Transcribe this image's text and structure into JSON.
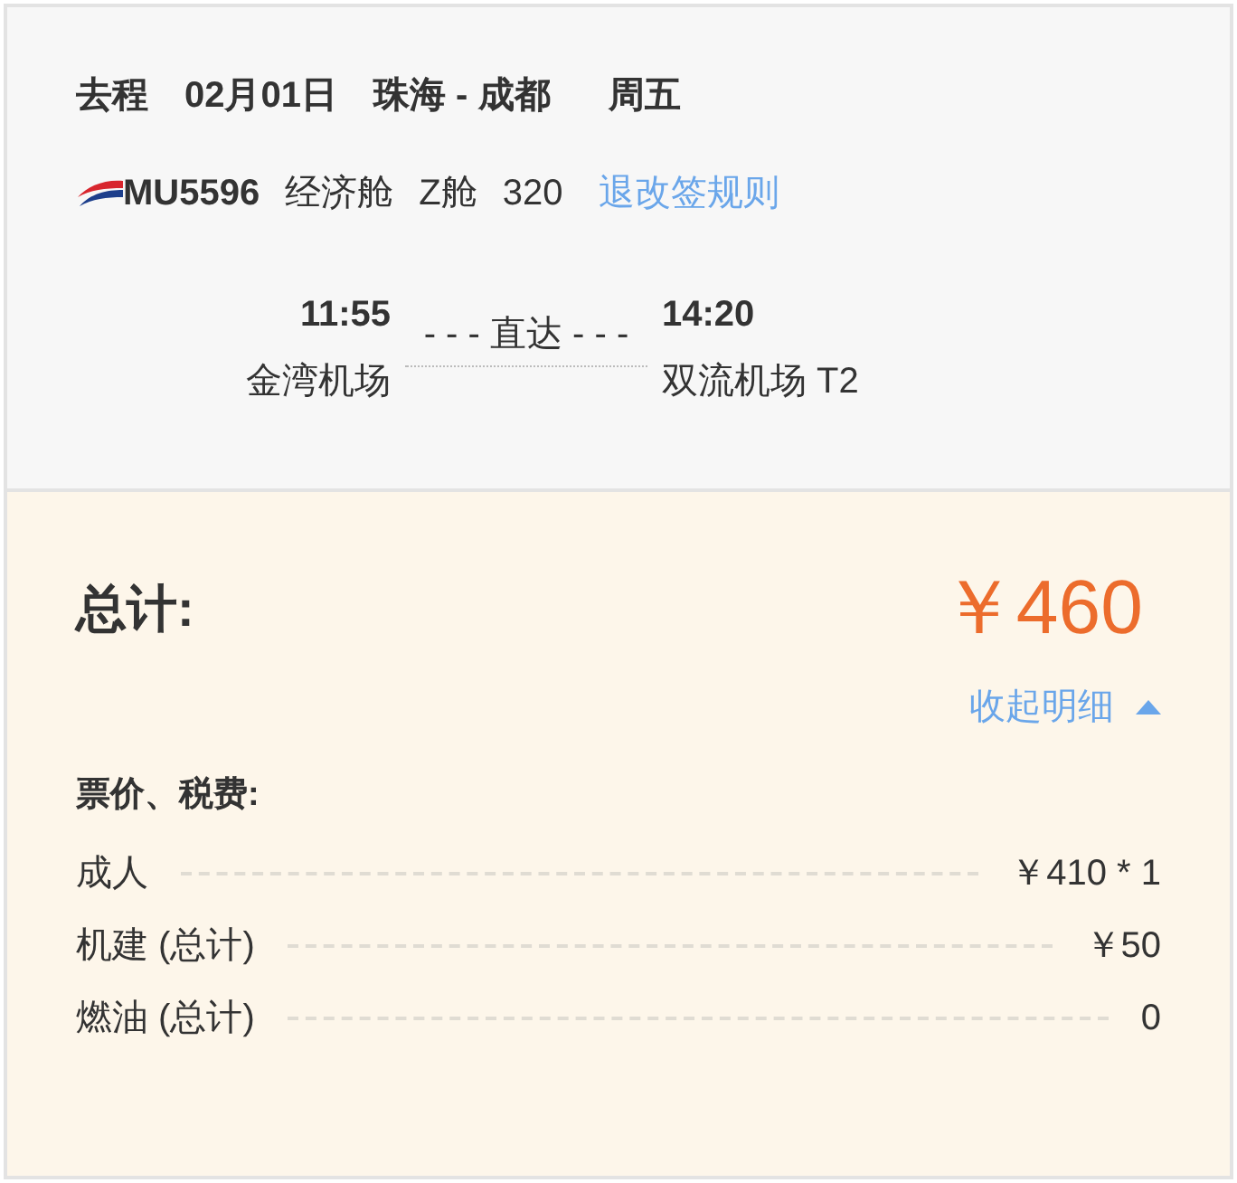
{
  "trip": {
    "segments": [
      "去程",
      "02月01日",
      "珠海 - 成都",
      "周五"
    ]
  },
  "flight": {
    "number": "MU5596",
    "details": [
      "经济舱",
      "Z舱",
      "320"
    ],
    "rules_link": "退改签规则"
  },
  "route": {
    "depart_time": "11:55",
    "depart_airport": "金湾机场",
    "stop_label": "- - - 直达 - - -",
    "arrive_time": "14:20",
    "arrive_airport": "双流机场 T2"
  },
  "total": {
    "label": "总计:",
    "amount": "￥460"
  },
  "details_toggle": {
    "label": "收起明细",
    "expanded": true
  },
  "fees": {
    "title": "票价、税费:",
    "rows": [
      {
        "label": "成人",
        "value": "￥410 * 1"
      },
      {
        "label": "机建 (总计)",
        "value": "￥50"
      },
      {
        "label": "燃油 (总计)",
        "value": "0"
      }
    ]
  }
}
